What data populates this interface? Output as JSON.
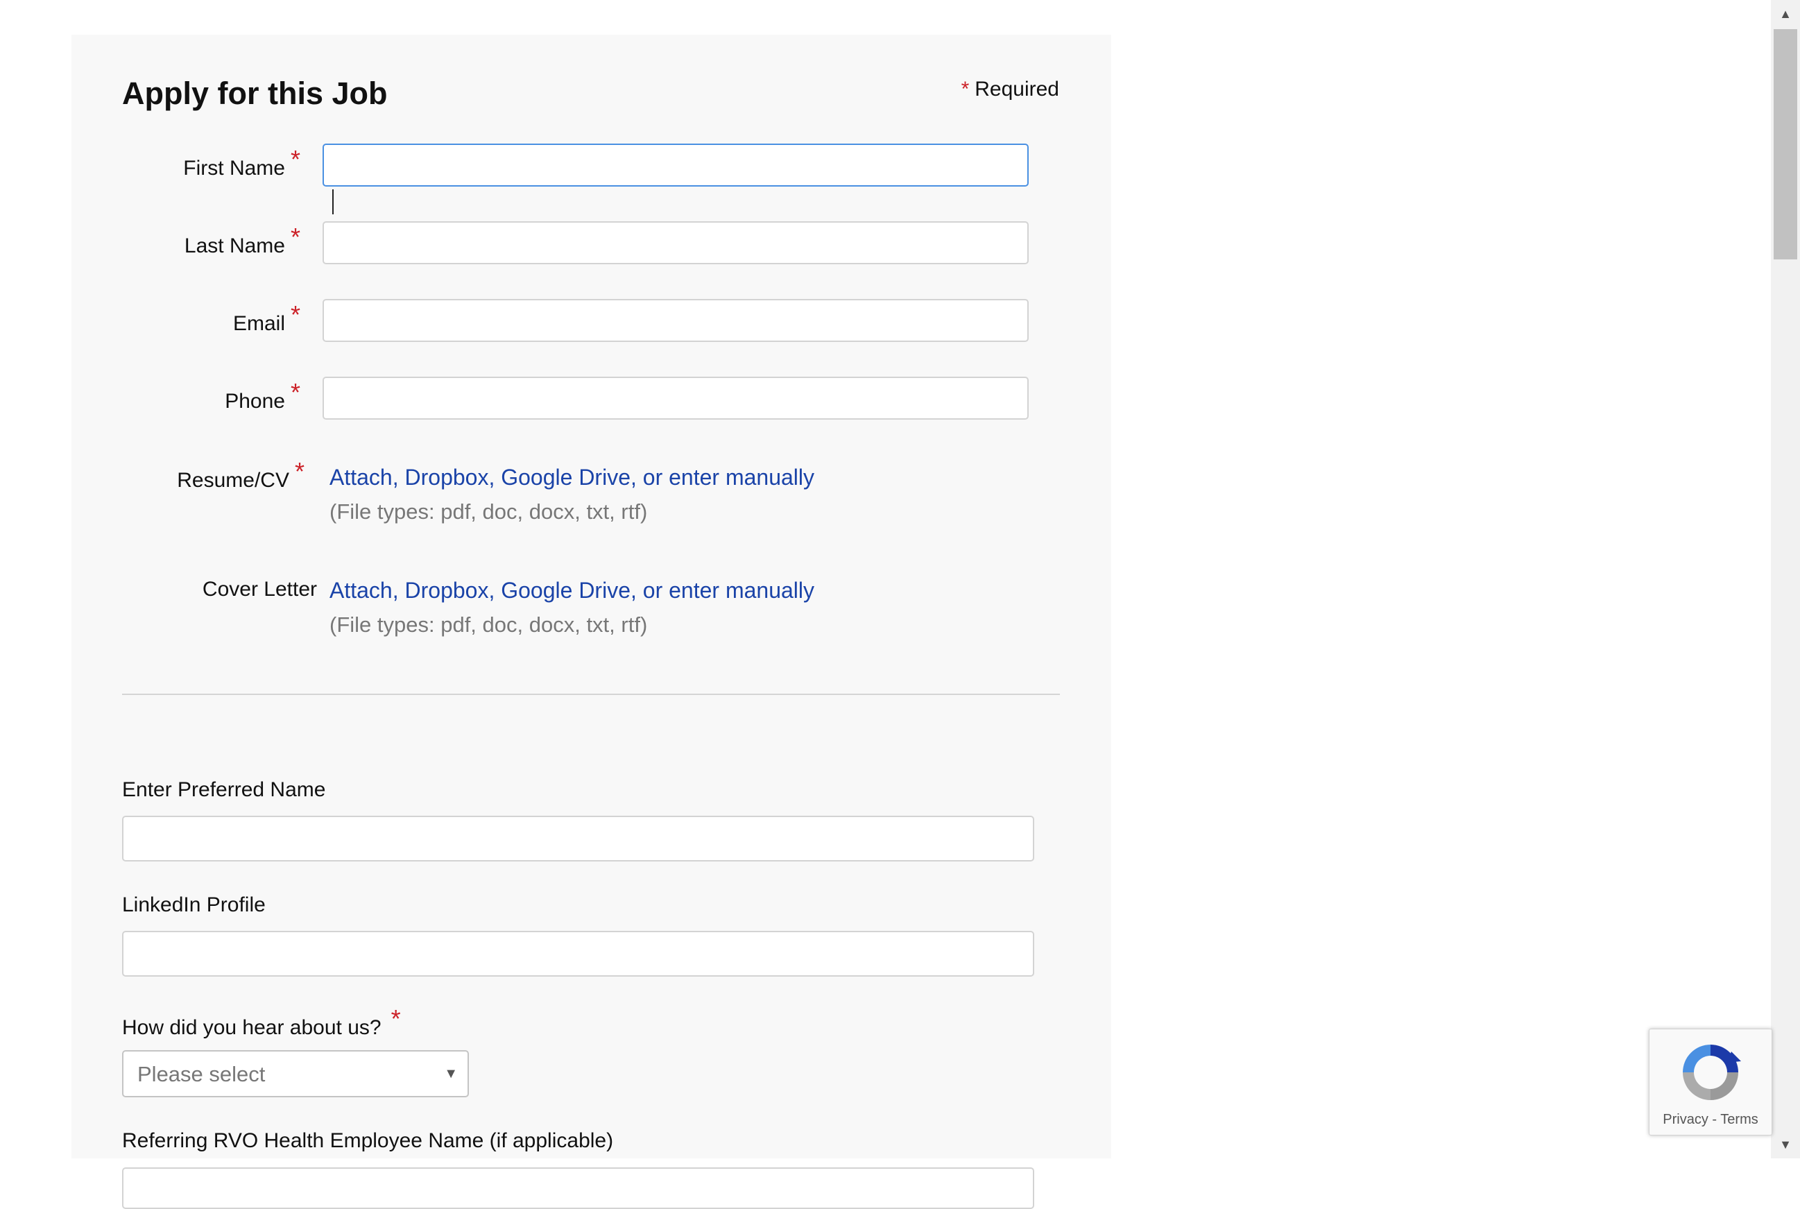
{
  "form": {
    "title": "Apply for this Job",
    "required_star": "*",
    "required_note": "Required",
    "fields": {
      "first_name": {
        "label": "First Name",
        "value": ""
      },
      "last_name": {
        "label": "Last Name",
        "value": ""
      },
      "email": {
        "label": "Email",
        "value": ""
      },
      "phone": {
        "label": "Phone",
        "value": ""
      }
    },
    "resume": {
      "label": "Resume/CV",
      "attach": "Attach",
      "dropbox": "Dropbox",
      "google_drive": "Google Drive",
      "or_enter": "or enter manually",
      "file_types": "(File types: pdf, doc, docx, txt, rtf)"
    },
    "cover_letter": {
      "label": "Cover Letter",
      "attach": "Attach",
      "dropbox": "Dropbox",
      "google_drive": "Google Drive",
      "or_enter": "or enter manually",
      "file_types": "(File types: pdf, doc, docx, txt, rtf)"
    },
    "preferred_name": {
      "label": "Enter Preferred Name",
      "value": ""
    },
    "linkedin": {
      "label": "LinkedIn Profile",
      "value": ""
    },
    "hear_about": {
      "label": "How did you hear about us?",
      "selected": "Please select"
    },
    "referring": {
      "label": "Referring RVO Health Employee Name (if applicable)"
    }
  },
  "recaptcha": {
    "privacy": "Privacy",
    "separator": "-",
    "terms": "Terms"
  },
  "colors": {
    "required_star": "#cc2229",
    "link": "#1a43a8",
    "focus_border": "#4a90e2",
    "panel_bg": "#f8f8f8"
  }
}
